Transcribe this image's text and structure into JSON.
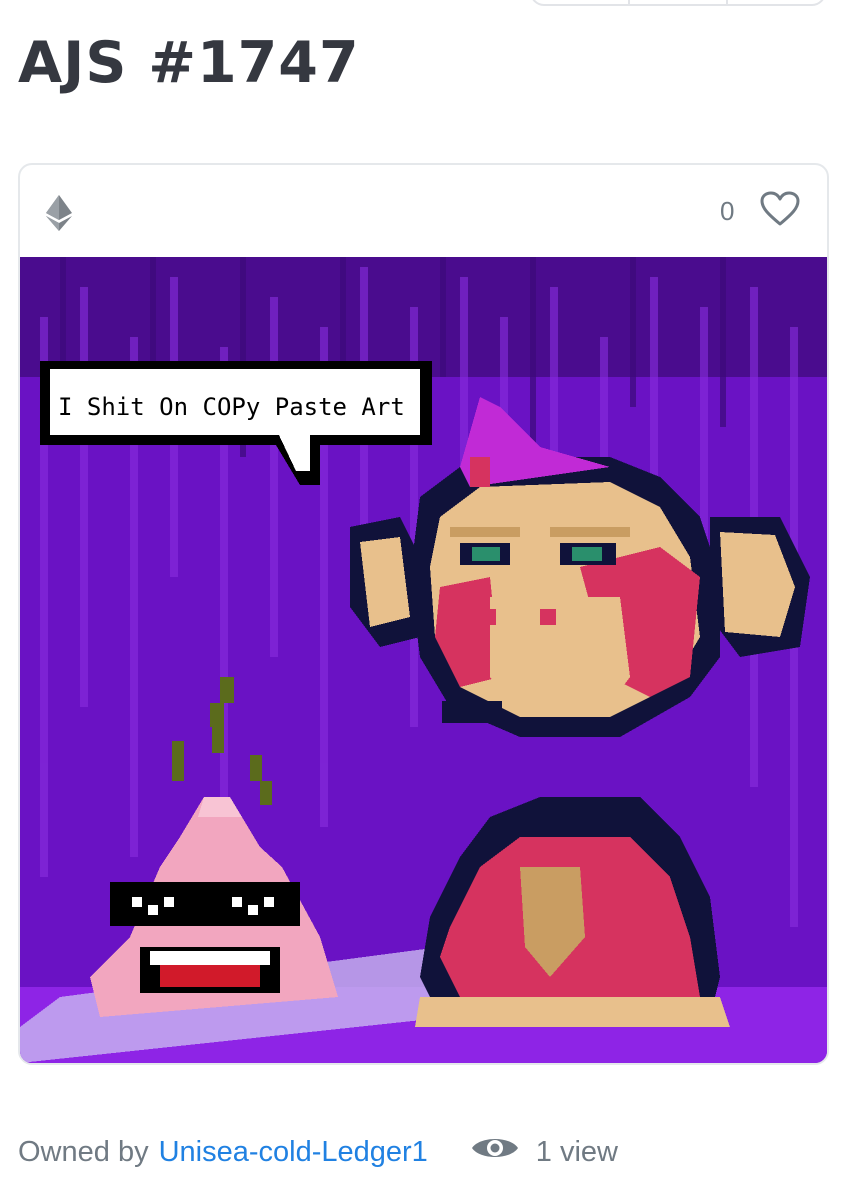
{
  "page": {
    "title": "AJS #1747"
  },
  "card": {
    "chain_icon": "ethereum-icon",
    "favorite_count": "0",
    "favorite_icon": "heart-icon",
    "speech_bubble_text": "I Shit On COPy Paste Art"
  },
  "footer": {
    "owned_by_label": "Owned by",
    "owner_name": "Unisea-cold-Ledger1",
    "views_icon": "eye-icon",
    "views_label": "1 view"
  },
  "colors": {
    "title": "#353840",
    "muted": "#707a83",
    "link": "#2081e2",
    "border": "#e5e8eb",
    "art_bg": "#6a12c4",
    "ape_fur": "#e8c08c",
    "ape_pink": "#d6335f",
    "ape_outline": "#10123a",
    "mohawk": "#c12ad6",
    "poop_pink": "#f0a0b8"
  }
}
